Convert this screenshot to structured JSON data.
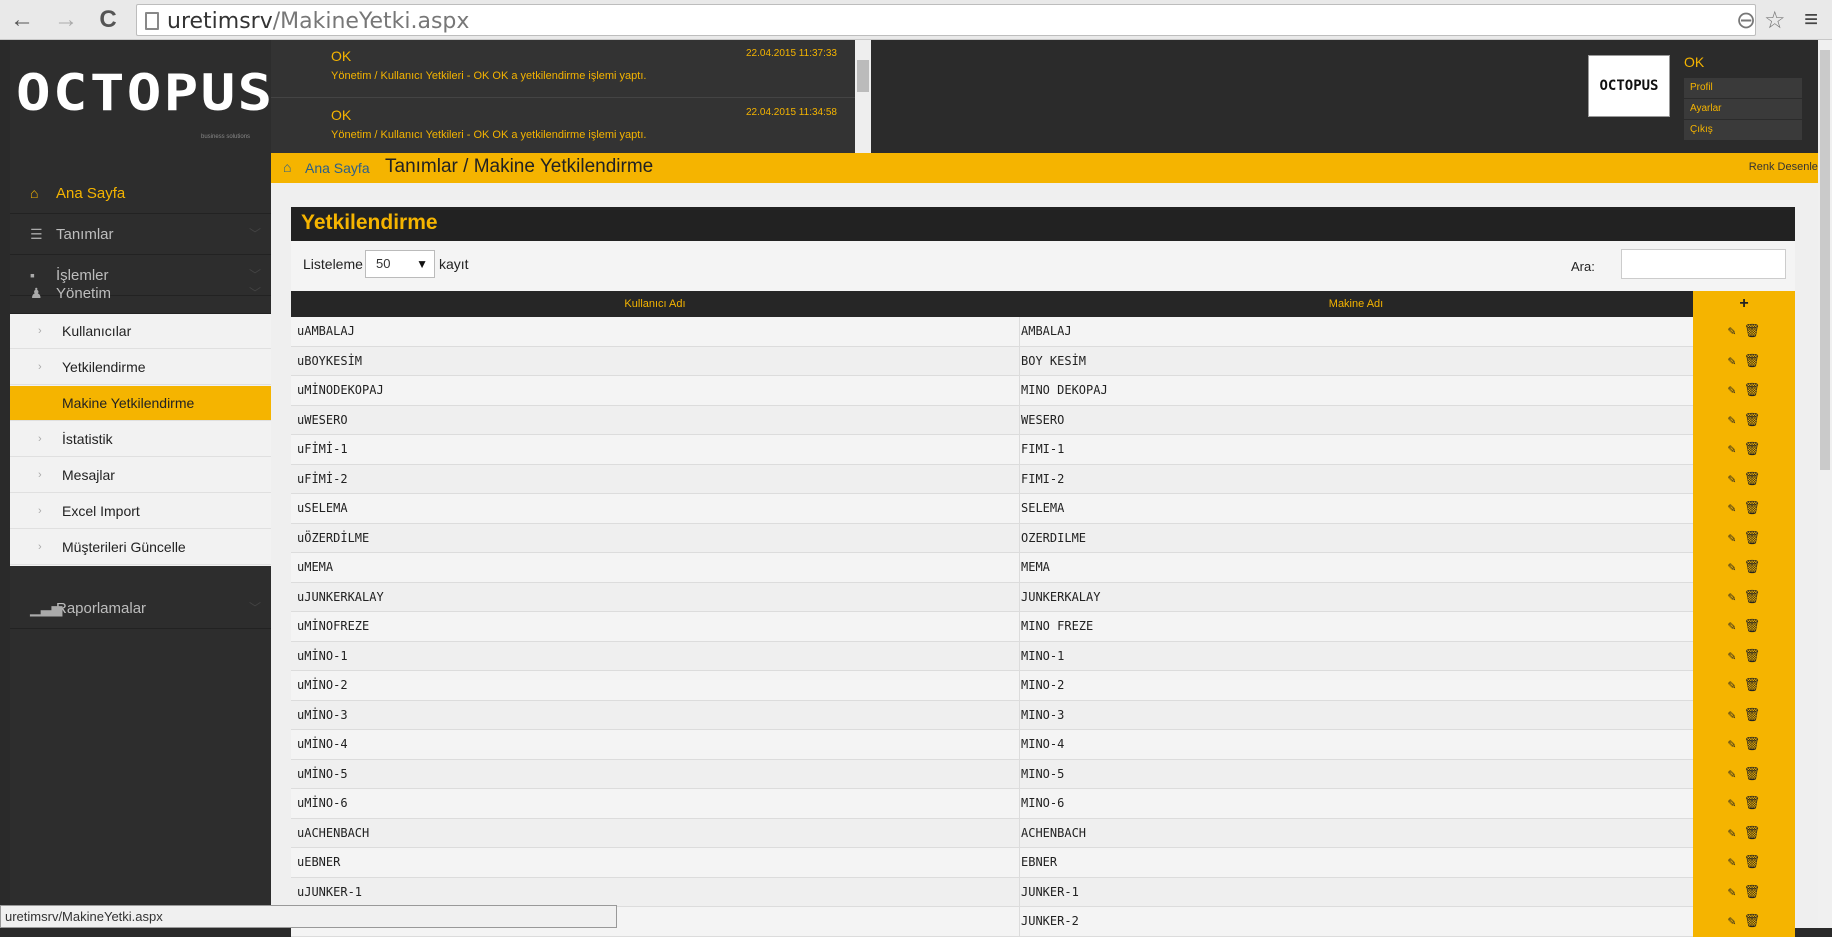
{
  "browser": {
    "url_host": "uretimsrv",
    "url_path": "/MakineYetki.aspx",
    "back": "←",
    "forward": "→",
    "reload": "C",
    "zoom": "⊖",
    "star": "☆",
    "menu": "≡"
  },
  "logo": {
    "text": "OCTOPUS",
    "sub": "business solutions"
  },
  "sidebar": {
    "home": "Ana Sayfa",
    "items": [
      {
        "label": "Tanımlar",
        "icon": "☰"
      },
      {
        "label": "İşlemler",
        "icon": "▪"
      },
      {
        "label": "Yönetim",
        "icon": "♟"
      }
    ],
    "sub": [
      "Kullanıcılar",
      "Yetkilendirme",
      "Makine Yetkilendirme",
      "İstatistik",
      "Mesajlar",
      "Excel Import",
      "Müşterileri Güncelle"
    ],
    "reports": "Raporlamalar"
  },
  "notifications": [
    {
      "title": "OK",
      "time": "22.04.2015 11:37:33",
      "msg": "Yönetim / Kullanıcı Yetkileri - OK OK a yetkilendirme işlemi yaptı."
    },
    {
      "title": "OK",
      "time": "22.04.2015 11:34:58",
      "msg": "Yönetim / Kullanıcı Yetkileri - OK OK a yetkilendirme işlemi yaptı."
    }
  ],
  "profile": {
    "image_text": "OCTOPUS",
    "name": "OK",
    "links": [
      "Profil",
      "Ayarlar",
      "Çıkış"
    ]
  },
  "breadcrumb": {
    "home": "Ana Sayfa",
    "title": "Tanımlar / Makine Yetkilendirme",
    "theme": "Renk Desenleri"
  },
  "panel": {
    "title": "Yetkilendirme",
    "list_label": "Listeleme",
    "list_value": "50",
    "list_after": "kayıt",
    "search_label": "Ara:"
  },
  "table": {
    "headers": {
      "user": "Kullanıcı Adı",
      "machine": "Makine Adı",
      "add": "+"
    },
    "rows": [
      [
        "uAMBALAJ",
        "AMBALAJ"
      ],
      [
        "uBOYKESİM",
        "BOY KESİM"
      ],
      [
        "uMİNODEKOPAJ",
        "MINO DEKOPAJ"
      ],
      [
        "uWESERO",
        "WESERO"
      ],
      [
        "uFİMİ-1",
        "FIMI-1"
      ],
      [
        "uFİMİ-2",
        "FIMI-2"
      ],
      [
        "uSELEMA",
        "SELEMA"
      ],
      [
        "uÖZERDİLME",
        "OZERDILME"
      ],
      [
        "uMEMA",
        "MEMA"
      ],
      [
        "uJUNKERKALAY",
        "JUNKERKALAY"
      ],
      [
        "uMİNOFREZE",
        "MINO FREZE"
      ],
      [
        "uMİNO-1",
        "MINO-1"
      ],
      [
        "uMİNO-2",
        "MINO-2"
      ],
      [
        "uMİNO-3",
        "MINO-3"
      ],
      [
        "uMİNO-4",
        "MINO-4"
      ],
      [
        "uMİNO-5",
        "MINO-5"
      ],
      [
        "uMİNO-6",
        "MINO-6"
      ],
      [
        "uACHENBACH",
        "ACHENBACH"
      ],
      [
        "uEBNER",
        "EBNER"
      ],
      [
        "uJUNKER-1",
        "JUNKER-1"
      ],
      [
        "",
        "JUNKER-2"
      ]
    ]
  },
  "status_bar": "uretimsrv/MakineYetki.aspx",
  "colors": {
    "accent": "#f5b400",
    "dark": "#2b2b2b",
    "link": "#2b5f8a"
  }
}
